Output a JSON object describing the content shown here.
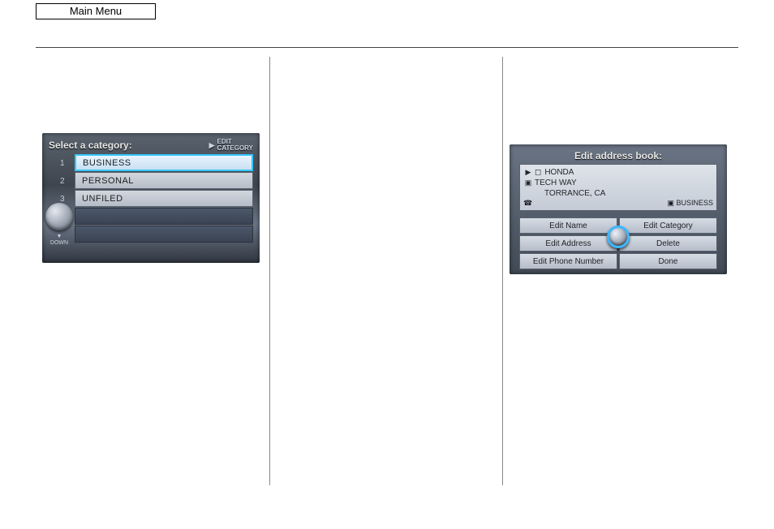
{
  "header": {
    "main_menu": "Main Menu"
  },
  "screen1": {
    "title": "Select a category:",
    "edit_category_label": "EDIT\nCATEGORY",
    "down_label": "▼\nDOWN",
    "indices": [
      "1",
      "2",
      "3"
    ],
    "rows": [
      {
        "label": "BUSINESS",
        "selected": true
      },
      {
        "label": "PERSONAL",
        "selected": false
      },
      {
        "label": "UNFILED",
        "selected": false
      }
    ]
  },
  "screen2": {
    "title": "Edit address book:",
    "name": "HONDA",
    "street": "TECH WAY",
    "city": "TORRANCE, CA",
    "phone_icon": "☎",
    "category_badge": "BUSINESS",
    "buttons": {
      "edit_name": "Edit Name",
      "edit_category": "Edit Category",
      "edit_address": "Edit Address",
      "delete": "Delete",
      "edit_phone": "Edit Phone Number",
      "done": "Done"
    }
  }
}
